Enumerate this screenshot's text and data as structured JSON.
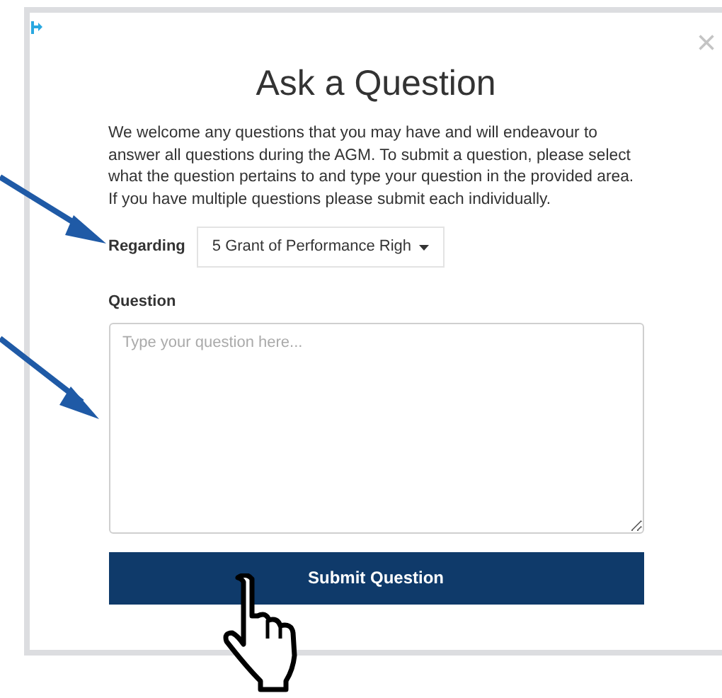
{
  "dialog": {
    "title": "Ask a Question",
    "close": "×",
    "intro": "We welcome any questions that you may have and will endeavour to answer all questions during the AGM. To submit a question, please select what the question pertains to and type your question in the provided area. If you have multiple questions please submit each individually.",
    "regarding": {
      "label": "Regarding",
      "value": "5 Grant of Performance Righ"
    },
    "question": {
      "label": "Question",
      "placeholder": "Type your question here..."
    },
    "submit": "Submit Question"
  }
}
